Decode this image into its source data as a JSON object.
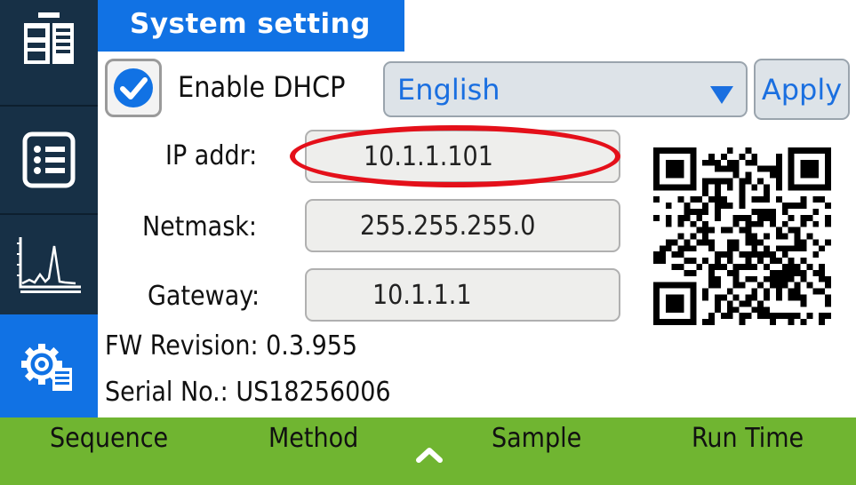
{
  "screen": {
    "title": "System setting"
  },
  "sidebar": {
    "items": [
      {
        "icon": "devices-icon",
        "active": false
      },
      {
        "icon": "list-icon",
        "active": false
      },
      {
        "icon": "chromatogram-icon",
        "active": false
      },
      {
        "icon": "settings-icon",
        "active": true
      }
    ]
  },
  "dhcp": {
    "label": "Enable DHCP",
    "checked": true
  },
  "language": {
    "selected": "English",
    "apply_label": "Apply"
  },
  "network": {
    "ip_label": "IP addr:",
    "ip_value": "10.1.1.101",
    "netmask_label": "Netmask:",
    "netmask_value": "255.255.255.0",
    "gateway_label": "Gateway:",
    "gateway_value": "10.1.1.1"
  },
  "info": {
    "fw_revision": "FW Revision: 0.3.955",
    "serial_no": "Serial No.: US18256006"
  },
  "bottom_nav": {
    "sequence": "Sequence",
    "method": "Method",
    "sample": "Sample",
    "run_time": "Run Time",
    "up_icon": "chevron-up-icon"
  },
  "colors": {
    "sidebar": "#173046",
    "accent_blue": "#1172e4",
    "bottom_bar": "#70b531",
    "highlight_red": "#e4101a"
  }
}
